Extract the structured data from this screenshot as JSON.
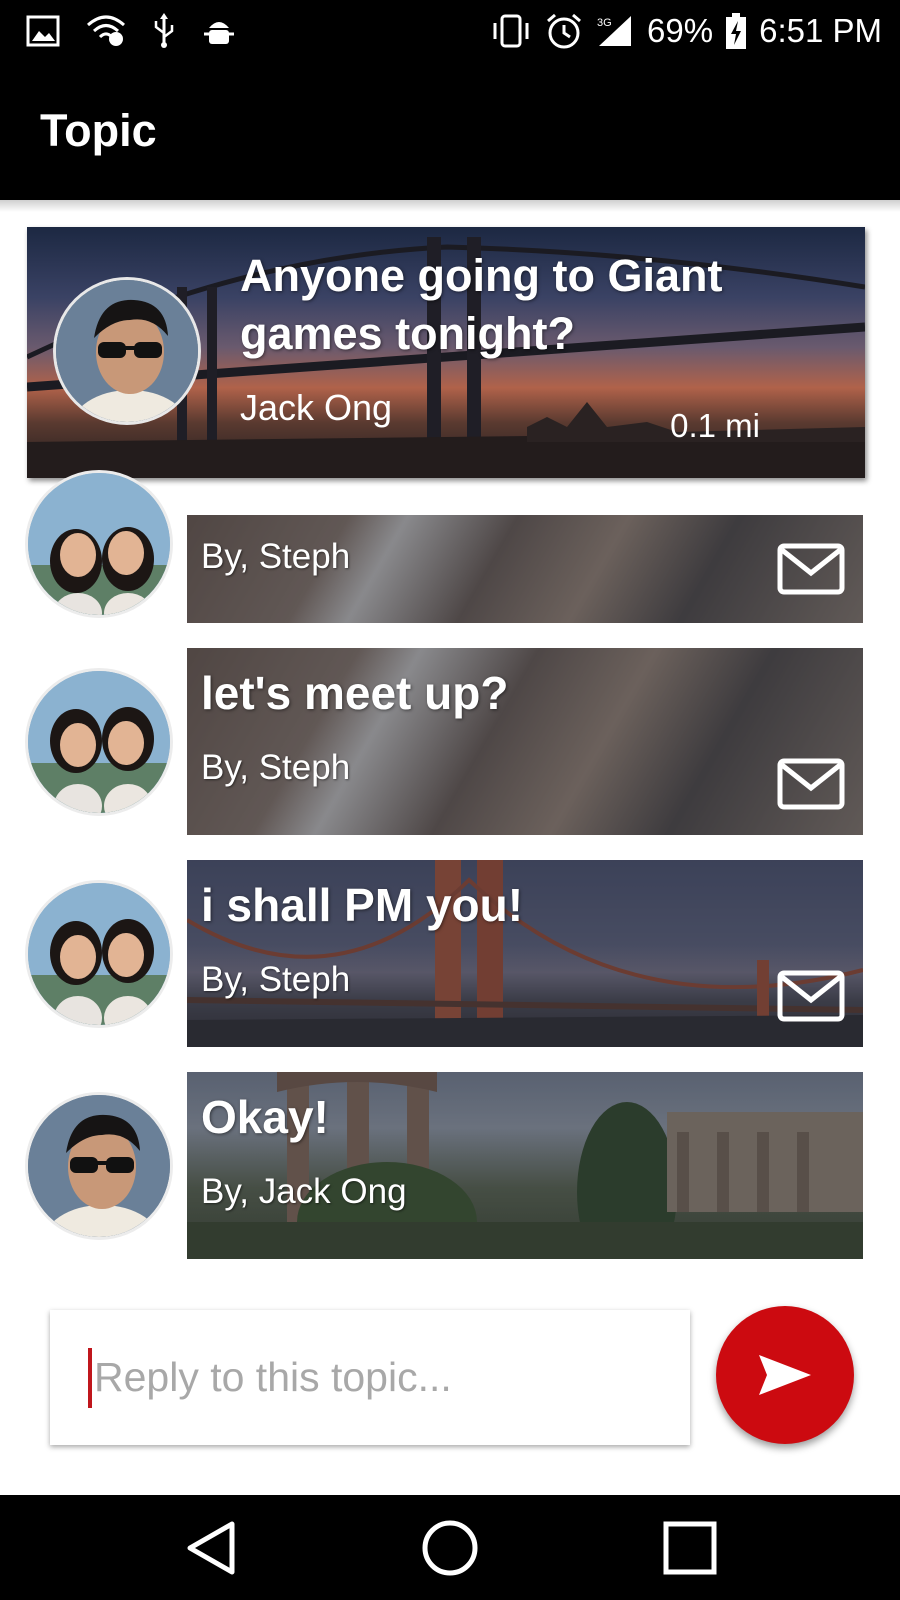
{
  "status_bar": {
    "battery_percent": "69%",
    "time": "6:51 PM",
    "network": "3G",
    "icons": [
      "gallery-icon",
      "wifi-icon",
      "usb-icon",
      "android-debug-icon",
      "vibrate-icon",
      "alarm-icon",
      "signal-icon",
      "battery-charging-icon"
    ]
  },
  "app_bar": {
    "title": "Topic"
  },
  "topic": {
    "title": "Anyone going to Giant games tonight?",
    "author": "Jack Ong",
    "distance": "0.1 mi"
  },
  "replies": [
    {
      "message": "",
      "by": "By, Steph",
      "has_mail": true
    },
    {
      "message": "let's meet up?",
      "by": "By, Steph",
      "has_mail": true
    },
    {
      "message": "i shall PM you!",
      "by": "By, Steph",
      "has_mail": true
    },
    {
      "message": "Okay!",
      "by": "By, Jack Ong",
      "has_mail": false
    }
  ],
  "reply_box": {
    "placeholder": "Reply to this topic..."
  },
  "colors": {
    "accent": "#cc0a10",
    "bar": "#000000"
  }
}
